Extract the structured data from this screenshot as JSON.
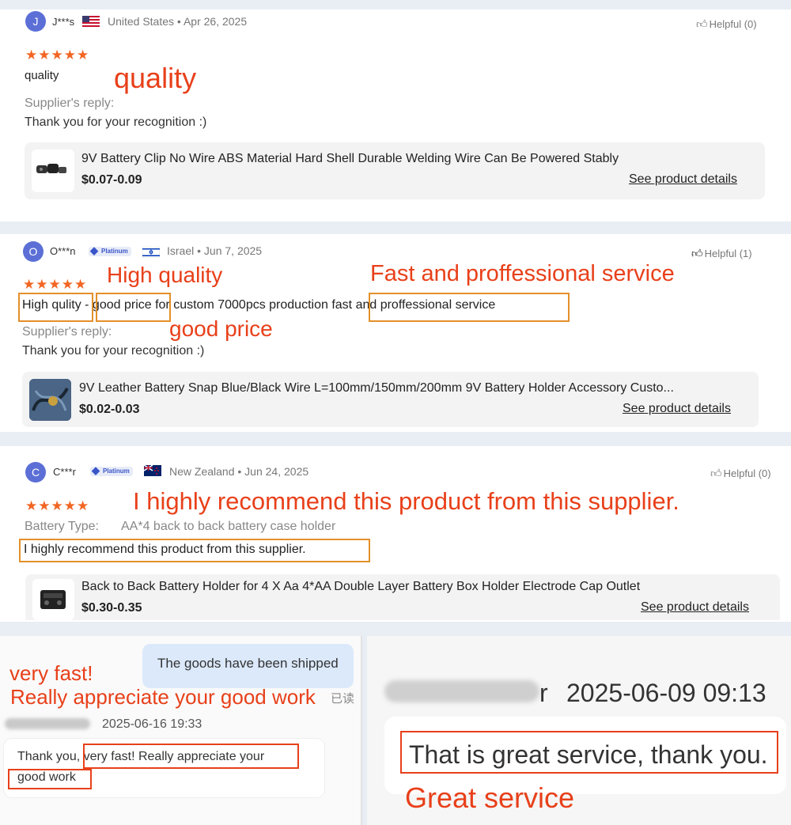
{
  "review1": {
    "avatar": "J",
    "name": "J***s",
    "country": "United States",
    "date": "• Apr 26, 2025",
    "stars": "★★★★★",
    "helpful": "Helpful (0)",
    "text": "quality",
    "annotation": "quality",
    "reply_label": "Supplier's reply:",
    "reply_text": "Thank you for your recognition :)",
    "product": {
      "title": "9V Battery Clip No Wire ABS Material Hard Shell Durable Welding Wire Can Be Powered Stably",
      "price": "$0.07-0.09",
      "link": "See product details"
    }
  },
  "review2": {
    "avatar": "O",
    "name": "O***n",
    "badge": "Platinum",
    "country": "Israel",
    "date": "• Jun 7, 2025",
    "stars": "★★★★★",
    "helpful": "Helpful (1)",
    "text_part1": "High qulity",
    "text_sep": " - ",
    "text_part2": "good price",
    "text_part3": " for custom 7000pcs production ",
    "text_part4": "fast and proffessional service",
    "annotation_high_quality": "High quality",
    "annotation_fast": "Fast and proffessional service",
    "annotation_good_price": "good price",
    "reply_label": "Supplier's reply:",
    "reply_text": "Thank you for your recognition :)",
    "product": {
      "title": "9V Leather Battery Snap Blue/Black Wire L=100mm/150mm/200mm 9V Battery Holder Accessory Custo...",
      "price": "$0.02-0.03",
      "link": "See product details"
    }
  },
  "review3": {
    "avatar": "C",
    "name": "C***r",
    "badge": "Platinum",
    "country": "New Zealand",
    "date": "• Jun 24, 2025",
    "stars": "★★★★★",
    "helpful": "Helpful (0)",
    "annotation": "I highly recommend this product from this supplier.",
    "attr_label": "Battery Type:",
    "attr_value": "AA*4 back to back battery case holder",
    "text": "I highly recommend this product from this supplier.",
    "product": {
      "title": "Back to Back Battery Holder for 4 X Aa 4*AA Double Layer Battery Box Holder Electrode Cap Outlet",
      "price": "$0.30-0.35",
      "link": "See product details"
    }
  },
  "chat_left": {
    "bubble_shipped": "The goods have been shipped",
    "annotation_line1": "very fast!",
    "annotation_line2": "Really appreciate your good work",
    "read_status": "已读",
    "sender_timestamp": "2025-06-16 19:33",
    "message_part1": "Thank you, ",
    "message_part2": "very fast! Really appreciate your",
    "message_part3": "good work"
  },
  "chat_right": {
    "sender_tail": "r",
    "timestamp": "2025-06-09 09:13",
    "message": "That is great service, thank you.",
    "annotation": "Great service"
  },
  "colors": {
    "accent": "#f26522",
    "annotation": "#e8401a",
    "highlight_box": "#e3902a",
    "avatar": "#5b6fd6"
  }
}
